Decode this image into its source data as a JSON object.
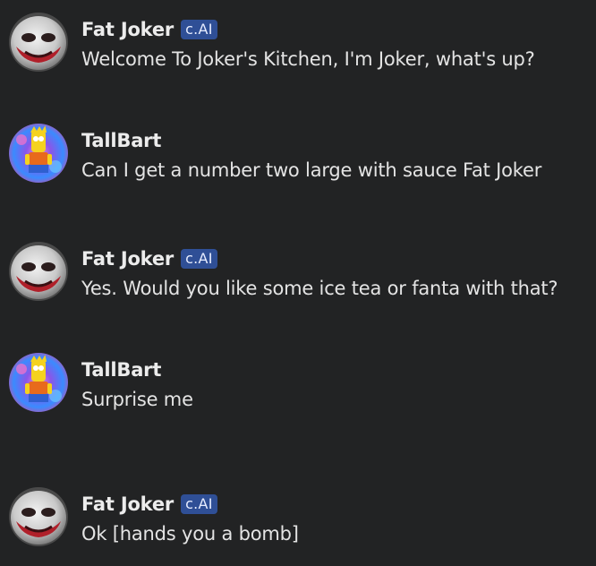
{
  "messages": [
    {
      "avatar_icon": "joker-avatar-icon",
      "author": "Fat Joker",
      "badge": "c.AI",
      "text": "Welcome To Joker's Kitchen, I'm Joker, what's up?"
    },
    {
      "avatar_icon": "bart-avatar-icon",
      "author": "TallBart",
      "badge": "",
      "text": "Can I get a number two large with sauce Fat Joker"
    },
    {
      "avatar_icon": "joker-avatar-icon",
      "author": "Fat Joker",
      "badge": "c.AI",
      "text": "Yes. Would you like some ice tea or fanta with that?"
    },
    {
      "avatar_icon": "bart-avatar-icon",
      "author": "TallBart",
      "badge": "",
      "text": "Surprise me"
    },
    {
      "avatar_icon": "joker-avatar-icon",
      "author": "Fat Joker",
      "badge": "c.AI",
      "text": "Ok [hands you a bomb]"
    }
  ],
  "colors": {
    "background": "#222324",
    "badge_background": "#2f4f96",
    "text": "#e4e4e4"
  }
}
